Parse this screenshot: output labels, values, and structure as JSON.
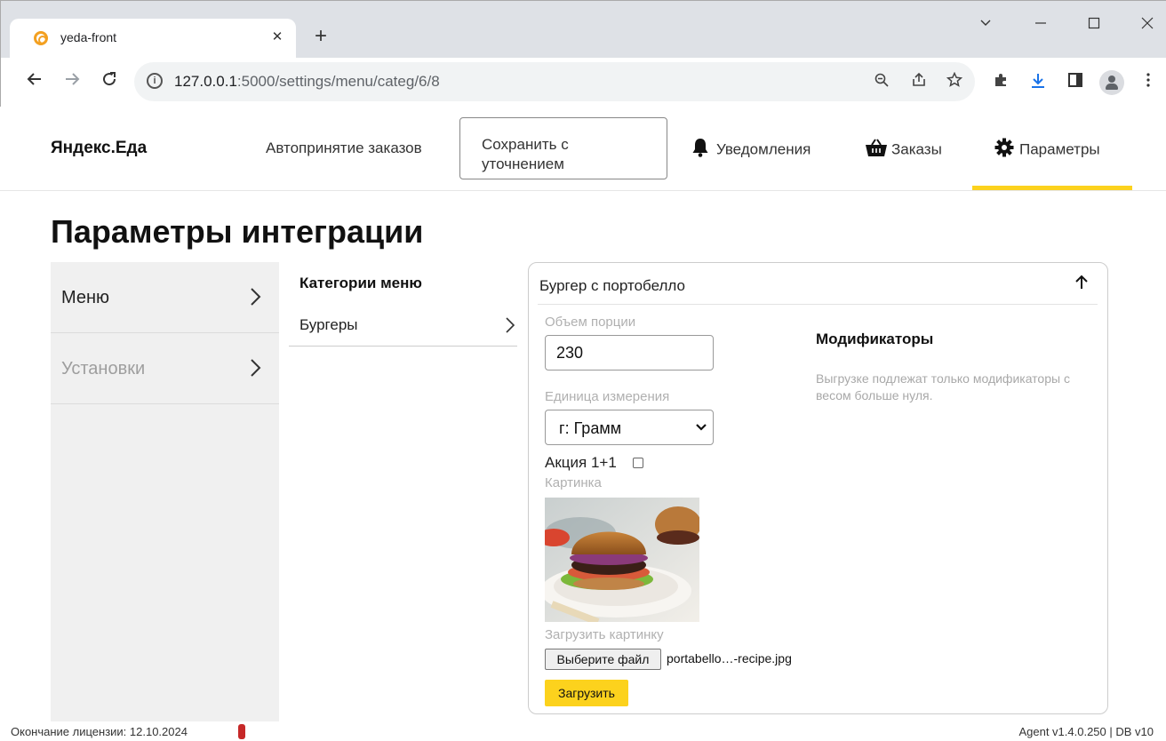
{
  "browser": {
    "tab_title": "yeda-front",
    "tab_close": "✕",
    "new_tab": "+",
    "url_host": "127.0.0.1",
    "url_path": ":5000/settings/menu/categ/6/8"
  },
  "header": {
    "brand": "Яндекс.Еда",
    "auto_accept": "Автопринятие заказов",
    "save_with_clarification_line1": "Сохранить с",
    "save_with_clarification_line2": "уточнением",
    "notifications": "Уведомления",
    "orders": "Заказы",
    "settings": "Параметры"
  },
  "page": {
    "title": "Параметры интеграции"
  },
  "sidebar": {
    "items": [
      {
        "label": "Меню",
        "active": true
      },
      {
        "label": "Установки",
        "active": false
      }
    ]
  },
  "categories": {
    "heading": "Категории меню",
    "items": [
      {
        "label": "Бургеры"
      }
    ]
  },
  "item": {
    "title": "Бургер с портобелло",
    "portion_label": "Объем порции",
    "portion_value": "230",
    "unit_label": "Единица измерения",
    "unit_value": "г: Грамм",
    "promo_label": "Акция 1+1",
    "promo_checked": false,
    "picture_label": "Картинка",
    "upload_picture_label": "Загрузить картинку",
    "choose_file_label": "Выберите файл",
    "file_name": "portabello…-recipe.jpg",
    "upload_button": "Загрузить",
    "modifiers_title": "Модификаторы",
    "modifiers_note": "Выгрузке подлежат только модификаторы с весом больше нуля."
  },
  "footer": {
    "license": "Окончание лицензии: 12.10.2024",
    "version": "Agent v1.4.0.250  |  DB v10"
  },
  "colors": {
    "accent": "#fcd21d",
    "license_flag": "#c62828",
    "sidebar_bg": "#f0f0f0"
  }
}
